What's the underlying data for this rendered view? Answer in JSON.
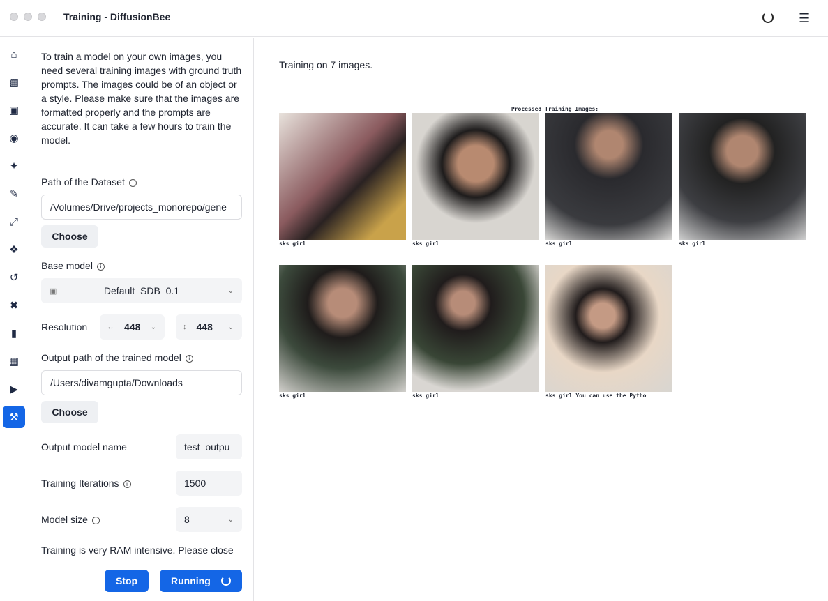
{
  "window": {
    "title": "Training - DiffusionBee"
  },
  "sidebar": {
    "icons": [
      "home-icon",
      "image-file-icon",
      "images-icon",
      "palette-icon",
      "magic-wand-icon",
      "brush-icon",
      "expand-icon",
      "cubes-icon",
      "history-icon",
      "tools-icon",
      "file-icon",
      "photo-stack-icon",
      "video-icon",
      "hammer-icon"
    ],
    "active": "hammer-icon",
    "accent": "#1466e6"
  },
  "panel": {
    "intro": "To train a model on your own images, you need several training images with ground truth prompts. The images could be of an object or a style. Please make sure that the images are formatted properly and the prompts are accurate. It can take a few hours to train the model.",
    "dataset_label": "Path of the Dataset",
    "dataset_value": "/Volumes/Drive/projects_monorepo/gene",
    "choose_label": "Choose",
    "base_model_label": "Base model",
    "base_model_value": "Default_SDB_0.1",
    "resolution_label": "Resolution",
    "res_w": "448",
    "res_h": "448",
    "output_path_label": "Output path of the trained model",
    "output_path_value": "/Users/divamgupta/Downloads",
    "output_name_label": "Output model name",
    "output_name_value": "test_outpu",
    "iterations_label": "Training Iterations",
    "iterations_value": "1500",
    "model_size_label": "Model size",
    "model_size_value": "8",
    "warning": "Training is very RAM intensive. Please close",
    "stop_label": "Stop",
    "running_label": "Running"
  },
  "main": {
    "status": "Training on 7 images.",
    "processed_title": "Processed Training Images:",
    "captions": [
      "sks girl",
      "sks girl",
      "sks girl",
      "sks girl",
      "sks girl",
      "sks girl",
      "sks girl You can use the Pytho"
    ]
  }
}
